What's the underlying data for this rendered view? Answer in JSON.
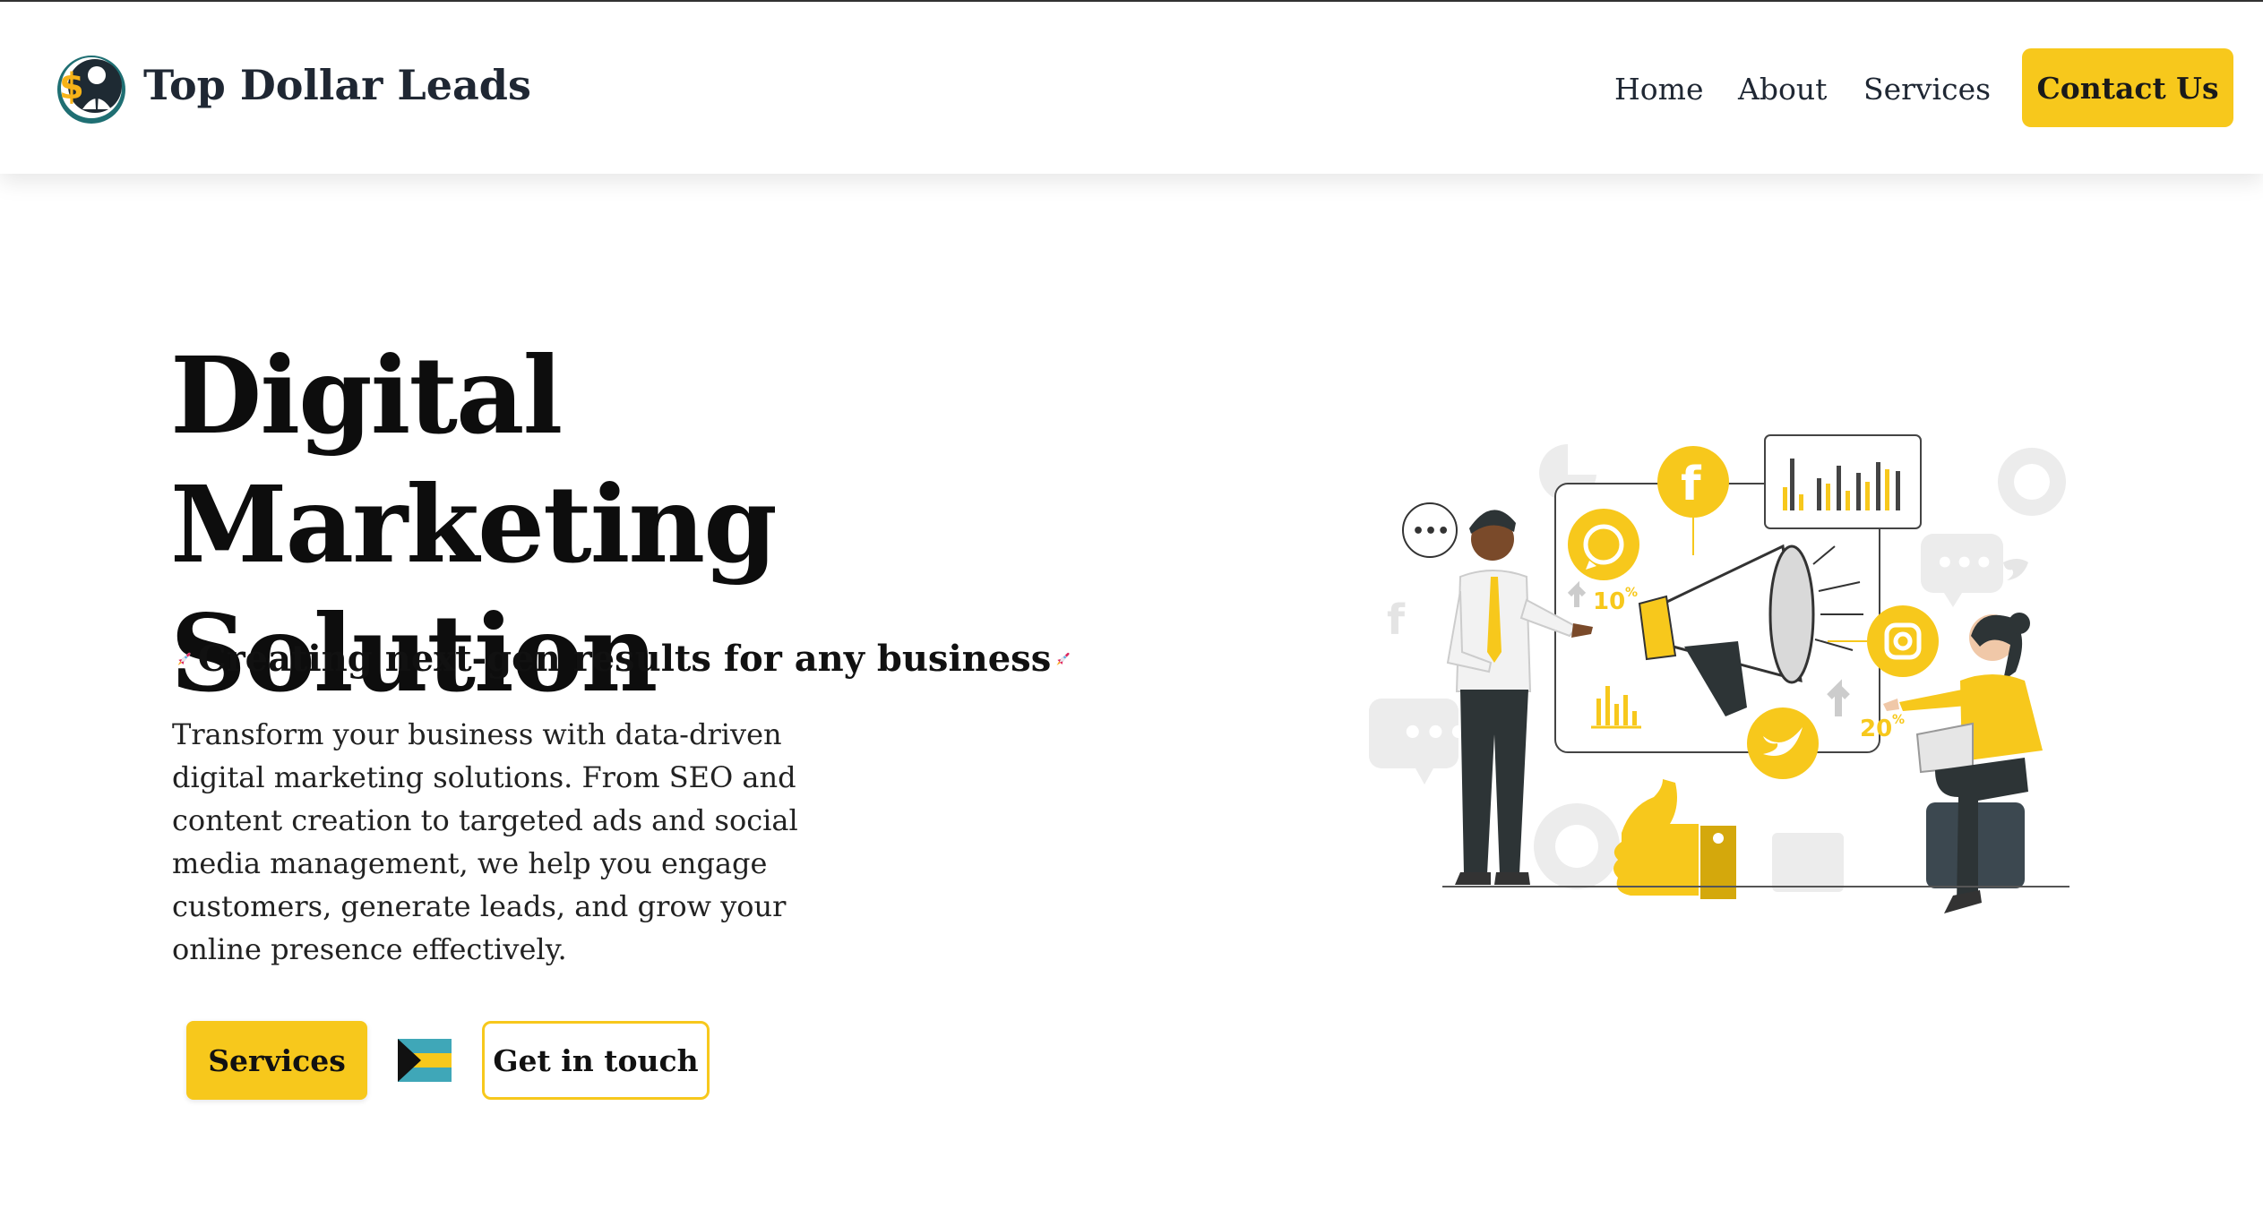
{
  "header": {
    "brand": "Top Dollar Leads",
    "nav": [
      {
        "label": "Home"
      },
      {
        "label": "About"
      },
      {
        "label": "Services"
      }
    ],
    "contact_label": "Contact Us"
  },
  "hero": {
    "title_line1": "Digital Marketing",
    "title_line2": "Solution",
    "tagline": "Creating next-gen results for any business",
    "description": "Transform your business with data-driven digital marketing solutions. From SEO and content creation to targeted ads and social media management, we help you engage customers, generate leads, and grow your online presence effectively.",
    "services_button": "Services",
    "contact_button": "Get in touch"
  },
  "illustration": {
    "badge_left": "10",
    "badge_right": "20",
    "badge_unit": "%"
  },
  "colors": {
    "accent": "#f7c81c",
    "text_dark": "#1f2733",
    "logo_teal": "#1f6f73"
  },
  "icons": [
    "logo-icon",
    "rocket-icon",
    "bahamas-flag-icon",
    "facebook-icon",
    "whatsapp-icon",
    "instagram-icon",
    "twitter-icon",
    "megaphone-icon",
    "thumbs-up-icon"
  ]
}
